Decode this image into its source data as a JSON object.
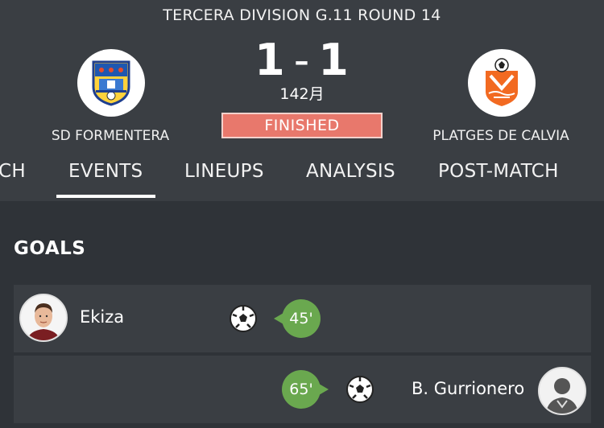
{
  "match": {
    "competition": "TERCERA DIVISION G.11 ROUND 14",
    "score_home": "1",
    "score_separator": "-",
    "score_away": "1",
    "minute": "142月",
    "status": "FINISHED",
    "status_color": "#e8786c",
    "home_team": {
      "name": "SD FORMENTERA",
      "logo_icon": "sd-formentera-crest"
    },
    "away_team": {
      "name": "PLATGES DE CALVIA",
      "logo_icon": "platges-de-calvia-crest"
    }
  },
  "tabs": [
    {
      "label": "CH",
      "active": false
    },
    {
      "label": "EVENTS",
      "active": true
    },
    {
      "label": "LINEUPS",
      "active": false
    },
    {
      "label": "ANALYSIS",
      "active": false
    },
    {
      "label": "POST-MATCH",
      "active": false
    }
  ],
  "goals": {
    "title": "GOALS",
    "events": [
      {
        "side": "home",
        "player": "Ekiza",
        "minute": "45'",
        "icon": "soccer-ball-icon",
        "avatar": "player-photo"
      },
      {
        "side": "away",
        "player": "B. Gurrionero",
        "minute": "65'",
        "icon": "soccer-ball-icon",
        "avatar": "player-silhouette"
      }
    ]
  },
  "colors": {
    "accent_green": "#6aa84f",
    "background": "#2f3338",
    "panel": "#3a3e43"
  }
}
